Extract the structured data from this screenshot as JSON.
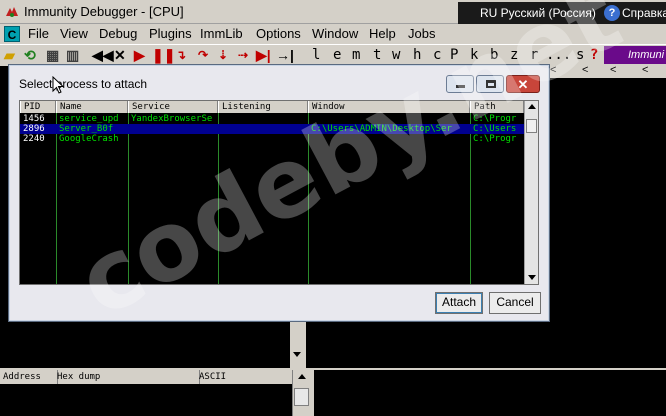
{
  "window": {
    "title": "Immunity Debugger - [CPU]",
    "language": "RU Русский (Россия)",
    "help": "Справка"
  },
  "menu": [
    "File",
    "View",
    "Debug",
    "Plugins",
    "ImmLib",
    "Options",
    "Window",
    "Help",
    "Jobs"
  ],
  "toolbar": {
    "letters": [
      "l",
      "e",
      "m",
      "t",
      "w",
      "h",
      "c",
      "P",
      "k",
      "b",
      "z",
      "r",
      "...",
      "s",
      "?"
    ],
    "badge": "Immuni",
    "nav_arrows": [
      "<",
      "<",
      "<",
      "<"
    ]
  },
  "dialog": {
    "title": "Select process to attach",
    "columns": [
      "PID",
      "Name",
      "Service",
      "Listening",
      "Window",
      "Path"
    ],
    "rows": [
      {
        "pid": "1456",
        "name": "service_upd",
        "service": "YandexBrowserSe",
        "listening": "",
        "window": "",
        "path": "C:\\Progr"
      },
      {
        "pid": "2896",
        "name": "Server_B0f",
        "service": "",
        "listening": "",
        "window": "C:\\Users\\ADMIN\\Desktop\\Ser",
        "path": "C:\\Users"
      },
      {
        "pid": "2240",
        "name": "GoogleCrash",
        "service": "",
        "listening": "",
        "window": "",
        "path": "C:\\Progr"
      }
    ],
    "attach_label": "Attach",
    "cancel_label": "Cancel"
  },
  "dump": {
    "columns": [
      "Address",
      "Hex dump",
      "ASCII"
    ]
  },
  "watermark": "codeby.net",
  "colors": {
    "row_text": "#00ff00",
    "selected_bg": "#000090",
    "badge_bg": "#6a0a8a",
    "close_btn": "#c8453a"
  }
}
